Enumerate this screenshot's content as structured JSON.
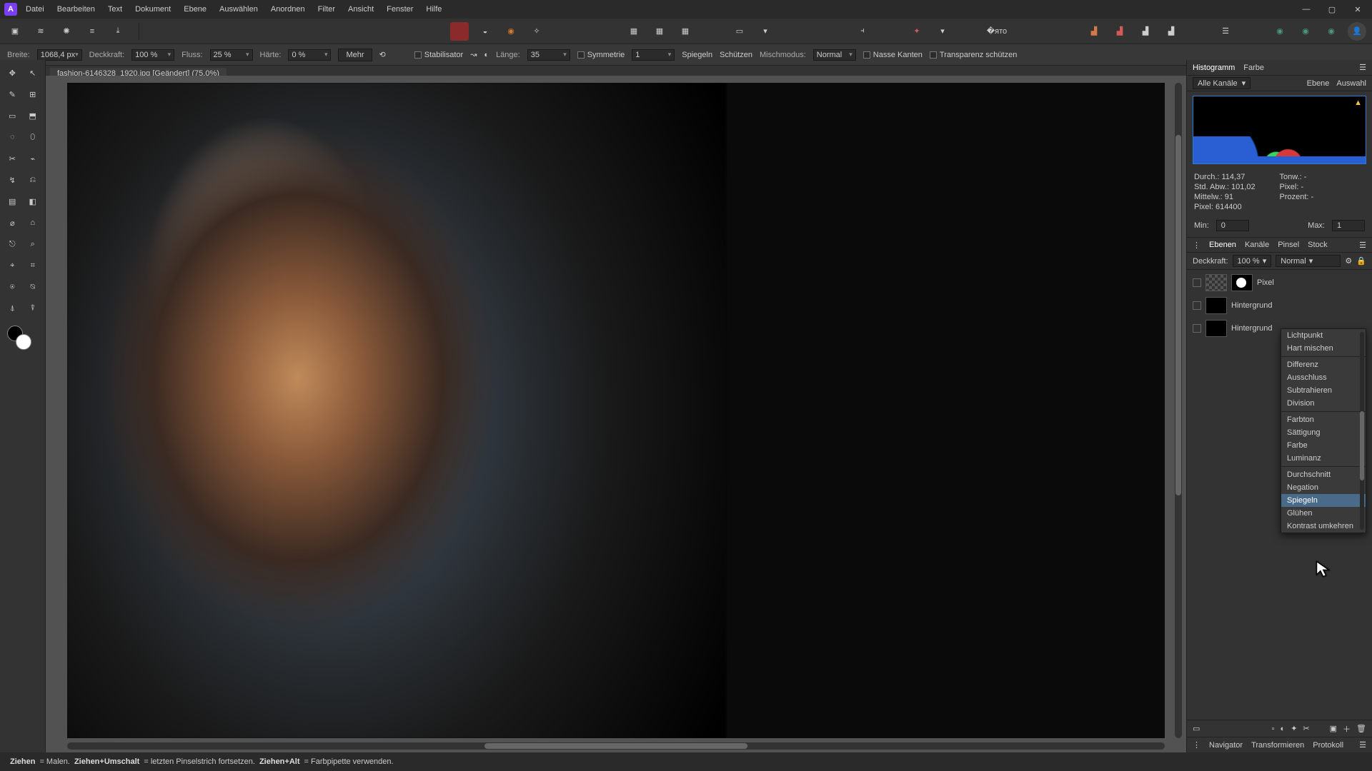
{
  "menu": {
    "items": [
      "Datei",
      "Bearbeiten",
      "Text",
      "Dokument",
      "Ebene",
      "Auswählen",
      "Anordnen",
      "Filter",
      "Ansicht",
      "Fenster",
      "Hilfe"
    ]
  },
  "window": {
    "min": "—",
    "max": "▢",
    "close": "✕"
  },
  "options": {
    "breite_label": "Breite:",
    "breite_val": "1068,4 px",
    "deck_label": "Deckkraft:",
    "deck_val": "100 %",
    "fluss_label": "Fluss:",
    "fluss_val": "25 %",
    "haerte_label": "Härte:",
    "haerte_val": "0 %",
    "mehr": "Mehr",
    "stab_label": "Stabilisator",
    "laenge_label": "Länge:",
    "laenge_val": "35",
    "sym_label": "Symmetrie",
    "sym_val": "1",
    "spiegeln": "Spiegeln",
    "schuetzen": "Schützen",
    "misch_label": "Mischmodus:",
    "misch_val": "Normal",
    "nasse": "Nasse Kanten",
    "transp": "Transparenz schützen"
  },
  "doc": {
    "title": "fashion-6146328_1920.jpg [Geändert] (75,0%)",
    "close": "×"
  },
  "tools": [
    "✥",
    "↖",
    "✎",
    "⊞",
    "▭",
    "⬒",
    "◌",
    "⬯",
    "✂",
    "⌁",
    "↯",
    "⎌",
    "▤",
    "◧",
    "⌀",
    "⌂",
    "⎋",
    "⌕",
    "⌖",
    "⌗",
    "⍟",
    "⍉",
    "⍋",
    "⍒"
  ],
  "right": {
    "top_tabs": [
      "Histogramm",
      "Farbe"
    ],
    "sub_channel": "Alle Kanäle",
    "sub_ebene": "Ebene",
    "sub_auswahl": "Auswahl",
    "stats": {
      "durch": "Durch.: 114,37",
      "tonw": "Tonw.: -",
      "stdabw": "Std. Abw.: 101,02",
      "pixel2": "Pixel: -",
      "mittelw": "Mittelw.: 91",
      "prozent": "Prozent: -",
      "pixel": "Pixel: 614400"
    },
    "min_label": "Min:",
    "min_val": "0",
    "max_label": "Max:",
    "max_val": "1",
    "layer_tabs": [
      "Ebenen",
      "Kanäle",
      "Pinsel",
      "Stock"
    ],
    "layer_deck": "Deckkraft:",
    "layer_deck_val": "100 %",
    "layer_mode": "Normal",
    "layers": [
      {
        "name": "Pixel"
      },
      {
        "name": "Hintergrund"
      },
      {
        "name": "Hintergrund"
      }
    ],
    "bot_tabs": [
      "Navigator",
      "Transformieren",
      "Protokoll"
    ]
  },
  "blend": {
    "items": [
      "Lichtpunkt",
      "Hart mischen",
      "",
      "Differenz",
      "Ausschluss",
      "Subtrahieren",
      "Division",
      "",
      "Farbton",
      "Sättigung",
      "Farbe",
      "Luminanz",
      "",
      "Durchschnitt",
      "Negation",
      "Spiegeln",
      "Glühen",
      "Kontrast umkehren"
    ],
    "hover": "Spiegeln"
  },
  "status": {
    "s1": "Ziehen",
    "s1d": " = Malen. ",
    "s2": "Ziehen+Umschalt",
    "s2d": " = letzten Pinselstrich fortsetzen. ",
    "s3": "Ziehen+Alt",
    "s3d": " = Farbpipette verwenden."
  }
}
